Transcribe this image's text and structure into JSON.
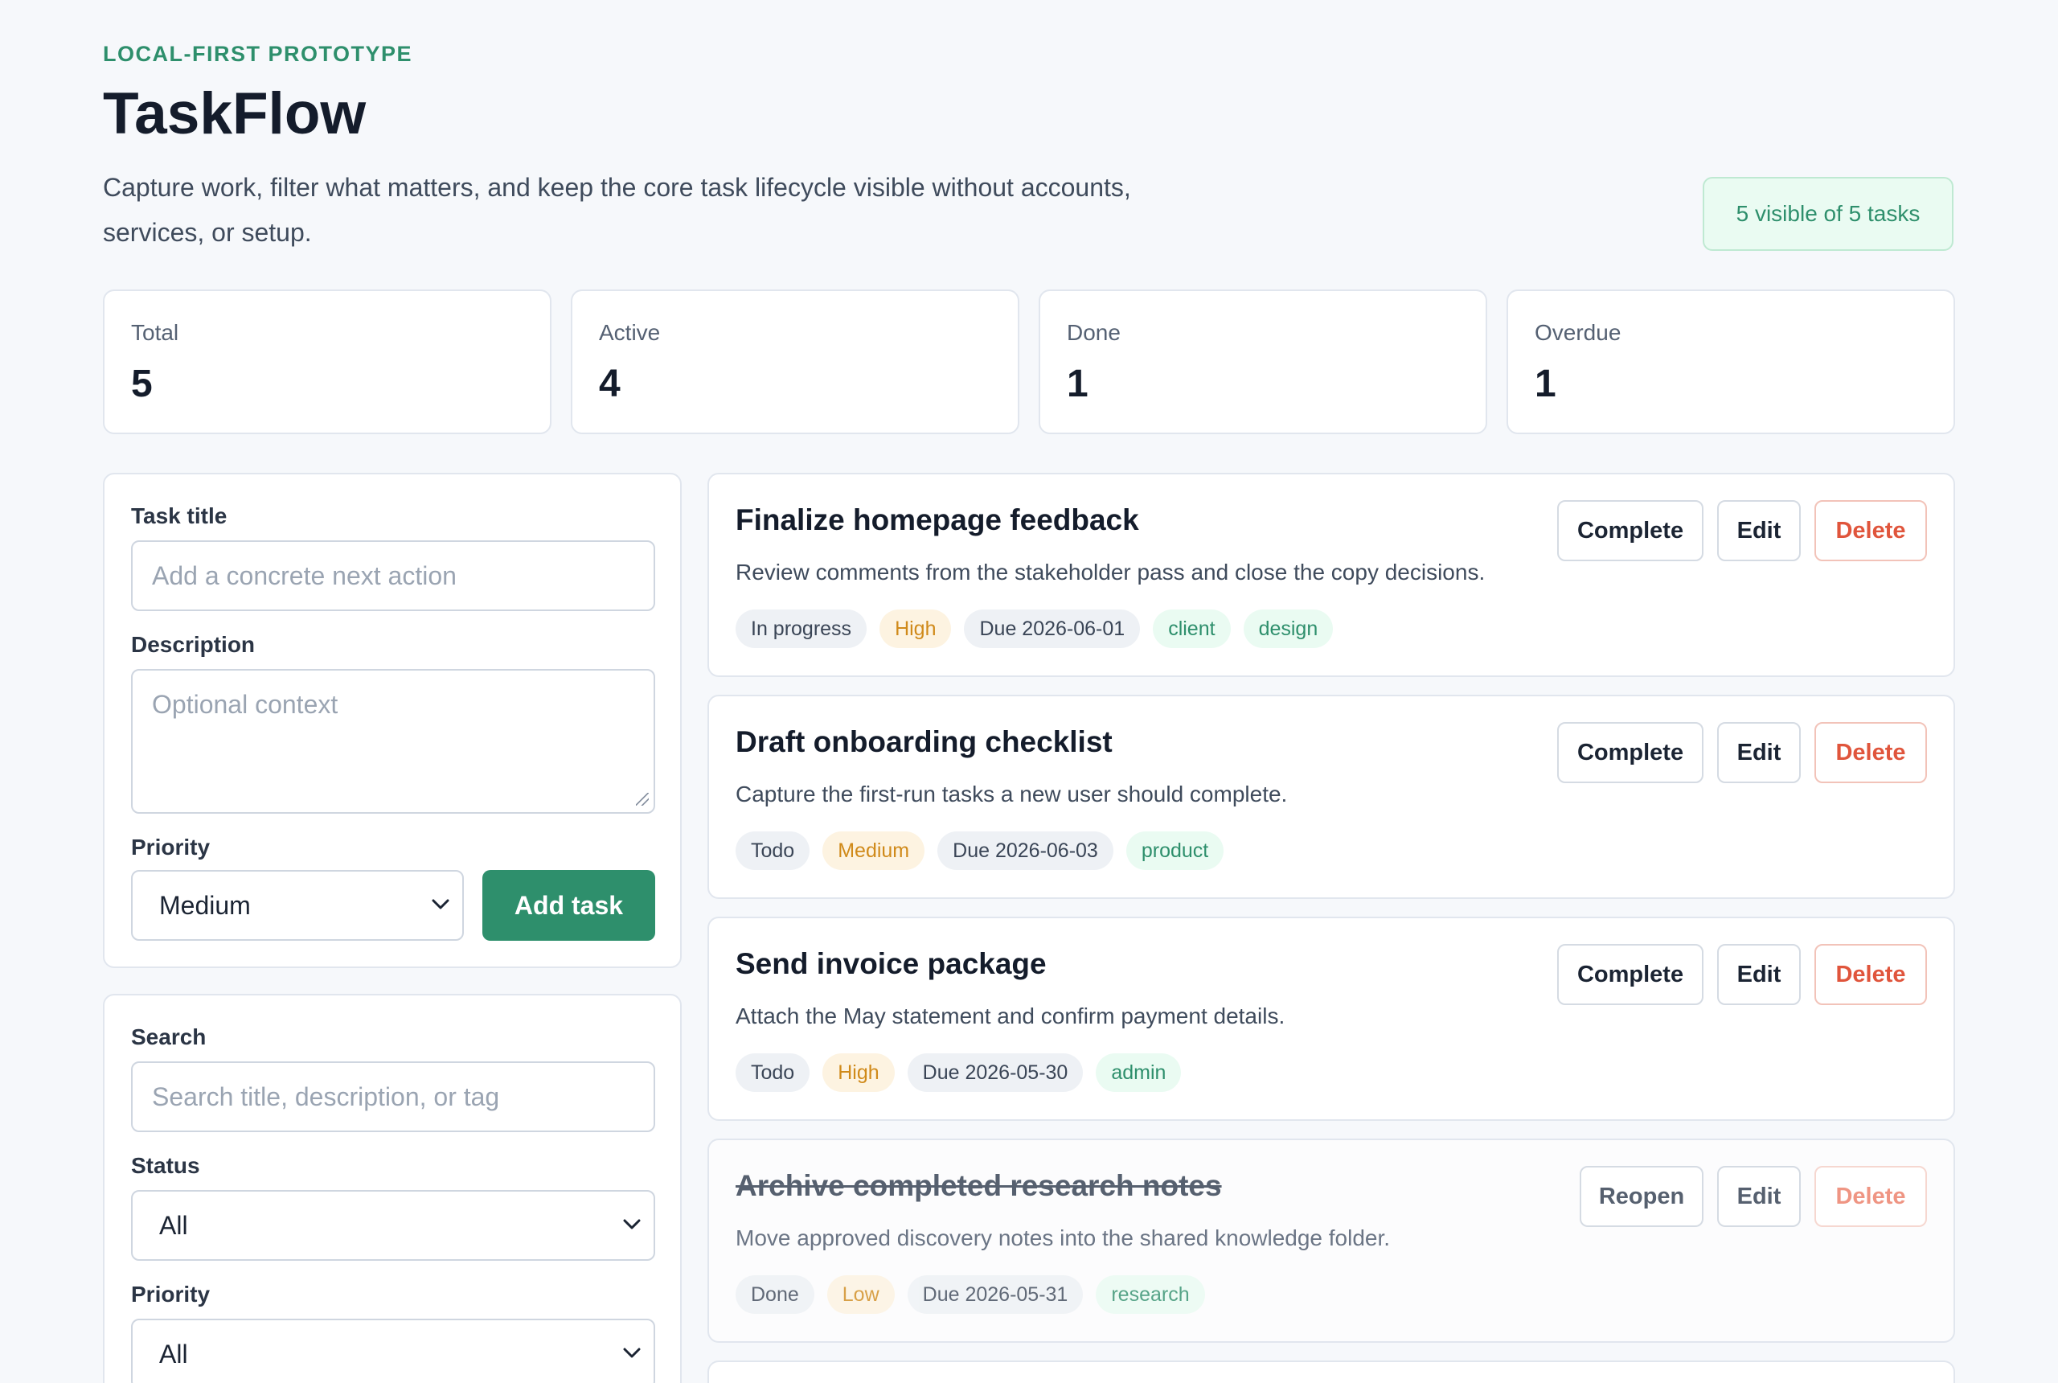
{
  "header": {
    "eyebrow": "LOCAL-FIRST PROTOTYPE",
    "title": "TaskFlow",
    "tagline": "Capture work, filter what matters, and keep the core task lifecycle visible without accounts, services, or setup.",
    "visible_badge": "5 visible of 5 tasks"
  },
  "stats": [
    {
      "label": "Total",
      "value": "5"
    },
    {
      "label": "Active",
      "value": "4"
    },
    {
      "label": "Done",
      "value": "1"
    },
    {
      "label": "Overdue",
      "value": "1"
    }
  ],
  "create_form": {
    "title_label": "Task title",
    "title_placeholder": "Add a concrete next action",
    "description_label": "Description",
    "description_placeholder": "Optional context",
    "priority_label": "Priority",
    "priority_value": "Medium",
    "add_button": "Add task"
  },
  "filters": {
    "search_label": "Search",
    "search_placeholder": "Search title, description, or tag",
    "status_label": "Status",
    "status_value": "All",
    "priority_label": "Priority",
    "priority_value": "All"
  },
  "tasks": [
    {
      "title": "Finalize homepage feedback",
      "description": "Review comments from the stakeholder pass and close the copy decisions.",
      "status": "In progress",
      "priority": "High",
      "due": "Due 2026-06-01",
      "tags": [
        "client",
        "design"
      ],
      "primary_action": "Complete",
      "edit": "Edit",
      "delete": "Delete"
    },
    {
      "title": "Draft onboarding checklist",
      "description": "Capture the first-run tasks a new user should complete.",
      "status": "Todo",
      "priority": "Medium",
      "due": "Due 2026-06-03",
      "tags": [
        "product"
      ],
      "primary_action": "Complete",
      "edit": "Edit",
      "delete": "Delete"
    },
    {
      "title": "Send invoice package",
      "description": "Attach the May statement and confirm payment details.",
      "status": "Todo",
      "priority": "High",
      "due": "Due 2026-05-30",
      "tags": [
        "admin"
      ],
      "primary_action": "Complete",
      "edit": "Edit",
      "delete": "Delete"
    },
    {
      "title": "Archive completed research notes",
      "description": "Move approved discovery notes into the shared knowledge folder.",
      "status": "Done",
      "priority": "Low",
      "due": "Due 2026-05-31",
      "tags": [
        "research"
      ],
      "primary_action": "Reopen",
      "edit": "Edit",
      "delete": "Delete"
    }
  ],
  "colors": {
    "accent": "#2e8f6c",
    "danger": "#e0553c",
    "priority_text": "#d08a1a",
    "background": "#f6f8fb"
  }
}
